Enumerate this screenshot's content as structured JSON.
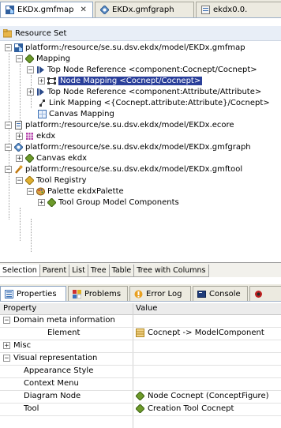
{
  "editor_tabs": [
    {
      "label": "EKDx.gmfmap",
      "close": "✕"
    },
    {
      "label": "EKDx.gmfgraph"
    },
    {
      "label": "ekdx0.0."
    }
  ],
  "resource_set": "Resource Set",
  "tree": [
    {
      "label": "platform:/resource/se.su.dsv.ekdx/model/EKDx.gmfmap"
    },
    {
      "label": "Mapping"
    },
    {
      "label": "Top Node Reference <component:Cocnept/Cocnept>"
    },
    {
      "label": "Node Mapping <Cocnept/Cocnept>"
    },
    {
      "label": "Top Node Reference <component:Attribute/Attribute>"
    },
    {
      "label": "Link Mapping <{Cocnept.attribute:Attribute}/Cocnept>"
    },
    {
      "label": "Canvas Mapping"
    },
    {
      "label": "platform:/resource/se.su.dsv.ekdx/model/EKDx.ecore"
    },
    {
      "label": "ekdx"
    },
    {
      "label": "platform:/resource/se.su.dsv.ekdx/model/EKDx.gmfgraph"
    },
    {
      "label": "Canvas ekdx"
    },
    {
      "label": "platform:/resource/se.su.dsv.ekdx/model/EKDx.gmftool"
    },
    {
      "label": "Tool Registry"
    },
    {
      "label": "Palette ekdxPalette"
    },
    {
      "label": "Tool Group Model Components"
    }
  ],
  "sub_tabs": [
    "Selection",
    "Parent",
    "List",
    "Tree",
    "Table",
    "Tree with Columns"
  ],
  "prop_tabs": [
    "Properties",
    "Problems",
    "Error Log",
    "Console"
  ],
  "prop_headers": {
    "property": "Property",
    "value": "Value"
  },
  "props": [
    {
      "key": "Domain meta information",
      "value": ""
    },
    {
      "key": "Element",
      "value": "Cocnept -> ModelComponent"
    },
    {
      "key": "Misc",
      "value": ""
    },
    {
      "key": "Visual representation",
      "value": ""
    },
    {
      "key": "Appearance Style",
      "value": ""
    },
    {
      "key": "Context Menu",
      "value": ""
    },
    {
      "key": "Diagram Node",
      "value": "Node Cocnept (ConceptFigure)"
    },
    {
      "key": "Tool",
      "value": "Creation Tool Cocnept"
    }
  ],
  "toggles": {
    "expanded": "−",
    "collapsed": "+"
  },
  "icons": {
    "gmfmap": "gmfmap-file-icon",
    "gmfgraph": "gmfgraph-file-icon",
    "resource": "resource-set-icon",
    "mapping": "diamond-icon",
    "top-node": "arrow-icon",
    "node-mapping": "node-icon",
    "link-mapping": "link-icon",
    "canvas": "canvas-icon",
    "ecore": "ecore-file-icon",
    "package": "package-icon",
    "tool": "wrench-icon",
    "palette": "palette-icon"
  },
  "colors": {
    "selection": "#2a3f9a",
    "tab_border": "#8aa2c0"
  }
}
